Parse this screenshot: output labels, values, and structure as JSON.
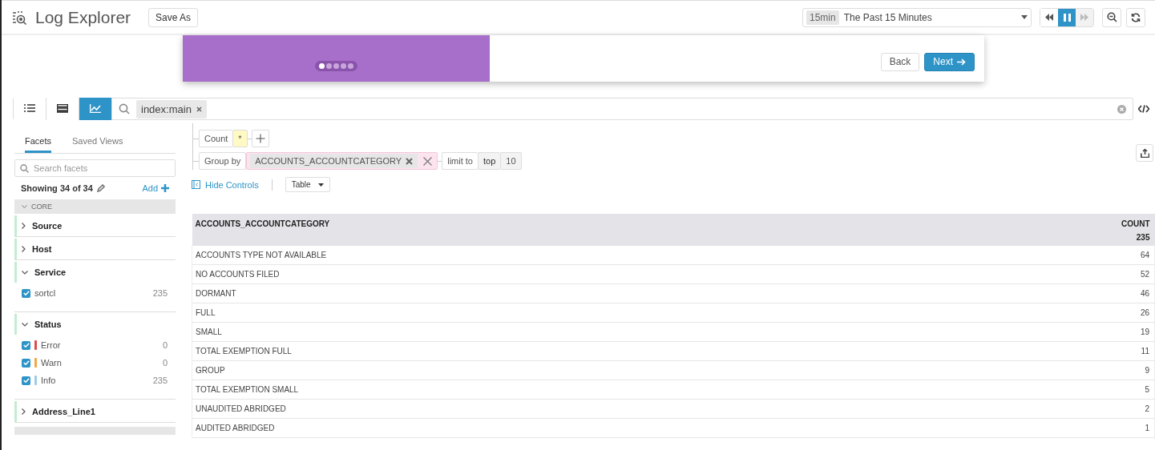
{
  "header": {
    "title": "Log Explorer",
    "save_button": "Save As",
    "time_badge": "15min",
    "time_range": "The Past 15 Minutes",
    "paused": true
  },
  "tour": {
    "dots": [
      {
        "selected": true
      },
      {
        "selected": false
      },
      {
        "selected": false
      },
      {
        "selected": false
      },
      {
        "selected": false
      }
    ],
    "back": "Back",
    "next": "Next"
  },
  "view_modes": [
    {
      "selected": false
    },
    {
      "selected": false
    },
    {
      "selected": true
    }
  ],
  "search": {
    "tag": "index:main"
  },
  "sidebar": {
    "tabs": [
      {
        "label": "Facets",
        "selected": true
      },
      {
        "label": "Saved Views",
        "selected": false
      }
    ],
    "placeholder": "Search facets",
    "showing": "Showing 34 of 34",
    "add": "Add",
    "section": "CORE",
    "groups": [
      {
        "name": "Source",
        "expanded": false
      },
      {
        "name": "Host",
        "expanded": false
      },
      {
        "name": "Service",
        "expanded": true,
        "items": [
          {
            "label": "sortcl",
            "count": "235",
            "checked": true
          }
        ]
      },
      {
        "name": "Status",
        "expanded": true,
        "items": [
          {
            "label": "Error",
            "count": "0",
            "checked": true,
            "color": "#e04b4b"
          },
          {
            "label": "Warn",
            "count": "0",
            "checked": true,
            "color": "#f0a848"
          },
          {
            "label": "Info",
            "count": "235",
            "checked": true,
            "color": "#9ccce6"
          }
        ]
      },
      {
        "name": "Address_Line1",
        "expanded": false
      }
    ]
  },
  "query": {
    "measure": "Count",
    "measure_value": "*",
    "group_by": "Group by",
    "group_field": "ACCOUNTS_ACCOUNTCATEGORY",
    "limit_label": "limit to",
    "limit_dir": "top",
    "limit_count": "10",
    "hide_controls": "Hide Controls",
    "display": "Table"
  },
  "table": {
    "columns": [
      "ACCOUNTS_ACCOUNTCATEGORY",
      "COUNT"
    ],
    "total": "235",
    "rows": [
      [
        "ACCOUNTS TYPE NOT AVAILABLE",
        "64"
      ],
      [
        "NO ACCOUNTS FILED",
        "52"
      ],
      [
        "DORMANT",
        "46"
      ],
      [
        "FULL",
        "26"
      ],
      [
        "SMALL",
        "19"
      ],
      [
        "TOTAL EXEMPTION FULL",
        "11"
      ],
      [
        "GROUP",
        "9"
      ],
      [
        "TOTAL EXEMPTION SMALL",
        "5"
      ],
      [
        "UNAUDITED ABRIDGED",
        "2"
      ],
      [
        "AUDITED ABRIDGED",
        "1"
      ]
    ]
  }
}
